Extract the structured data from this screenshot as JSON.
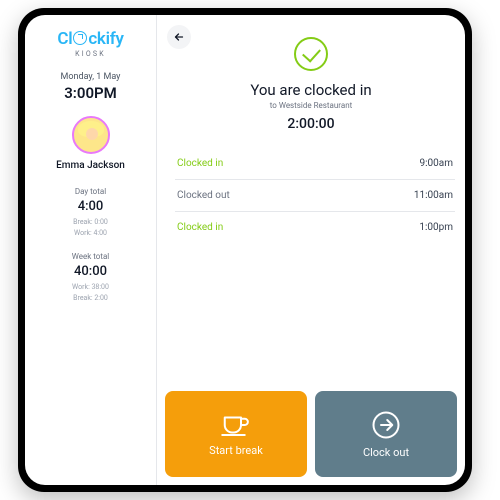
{
  "brand": {
    "name": "Clockify",
    "sub": "KIOSK"
  },
  "sidebar": {
    "date": "Monday, 1 May",
    "time": "3:00PM",
    "user_name": "Emma Jackson",
    "day": {
      "label": "Day total",
      "value": "4:00",
      "break": "Break: 0:00",
      "work": "Work: 4:00"
    },
    "week": {
      "label": "Week total",
      "value": "40:00",
      "work": "Work: 38:00",
      "break": "Break: 2:00"
    }
  },
  "main": {
    "status_title": "You are clocked in",
    "status_sub": "to Westside Restaurant",
    "elapsed": "2:00:00",
    "log": [
      {
        "label": "Clocked in",
        "time": "9:00am",
        "type": "in"
      },
      {
        "label": "Clocked out",
        "time": "11:00am",
        "type": "out"
      },
      {
        "label": "Clocked in",
        "time": "1:00pm",
        "type": "in"
      }
    ],
    "actions": {
      "break": "Start break",
      "out": "Clock out"
    }
  },
  "colors": {
    "accent_green": "#84cc16",
    "brand_blue": "#29b6f6",
    "break_orange": "#f59e0b",
    "clockout_slate": "#607d8b"
  }
}
